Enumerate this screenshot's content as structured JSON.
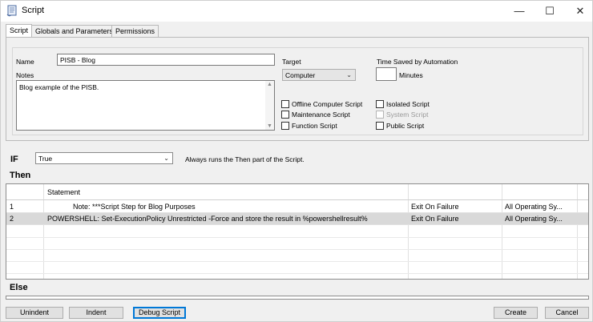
{
  "window": {
    "title": "Script",
    "controls": {
      "minimize": "—",
      "maximize": "☐",
      "close": "✕"
    }
  },
  "tabs": [
    {
      "label": "Script",
      "active": true
    },
    {
      "label": "Globals and Parameters",
      "active": false
    },
    {
      "label": "Permissions",
      "active": false
    }
  ],
  "form": {
    "name_label": "Name",
    "name_value": "PISB - Blog",
    "notes_label": "Notes",
    "notes_value": "Blog example of the PISB.",
    "target_label": "Target",
    "target_value": "Computer",
    "time_saved_label": "Time Saved by Automation",
    "time_saved_value": "",
    "minutes_label": "Minutes",
    "checkboxes": {
      "offline": {
        "label": "Offline Computer Script",
        "checked": false
      },
      "maintenance": {
        "label": "Maintenance Script",
        "checked": false
      },
      "function": {
        "label": "Function Script",
        "checked": false
      },
      "isolated": {
        "label": "Isolated Script",
        "checked": false
      },
      "system": {
        "label": "System Script",
        "checked": false,
        "disabled": true
      },
      "public": {
        "label": "Public Script",
        "checked": false
      }
    }
  },
  "condition": {
    "if_label": "IF",
    "if_value": "True",
    "description": "Always runs the Then part of the Script."
  },
  "then": {
    "label": "Then",
    "header": {
      "statement": "Statement"
    },
    "rows": [
      {
        "num": "1",
        "statement": "Note:  ***Script Step for Blog Purposes",
        "on_failure": "Exit On Failure",
        "os": "All Operating Sy...",
        "selected": false
      },
      {
        "num": "2",
        "statement": "POWERSHELL:  Set-ExecutionPolicy Unrestricted -Force and store the result in %powershellresult%",
        "on_failure": "Exit On Failure",
        "os": "All Operating Sy...",
        "selected": true
      }
    ]
  },
  "else": {
    "label": "Else"
  },
  "buttons": {
    "unindent": "Unindent",
    "indent": "Indent",
    "debug": "Debug Script",
    "create": "Create",
    "cancel": "Cancel"
  },
  "icons": {
    "app": "script-scroll-icon",
    "dropdown": "chevron-down-icon"
  },
  "colors": {
    "accent": "#0078d7",
    "selected_row": "#d9d9d9"
  }
}
